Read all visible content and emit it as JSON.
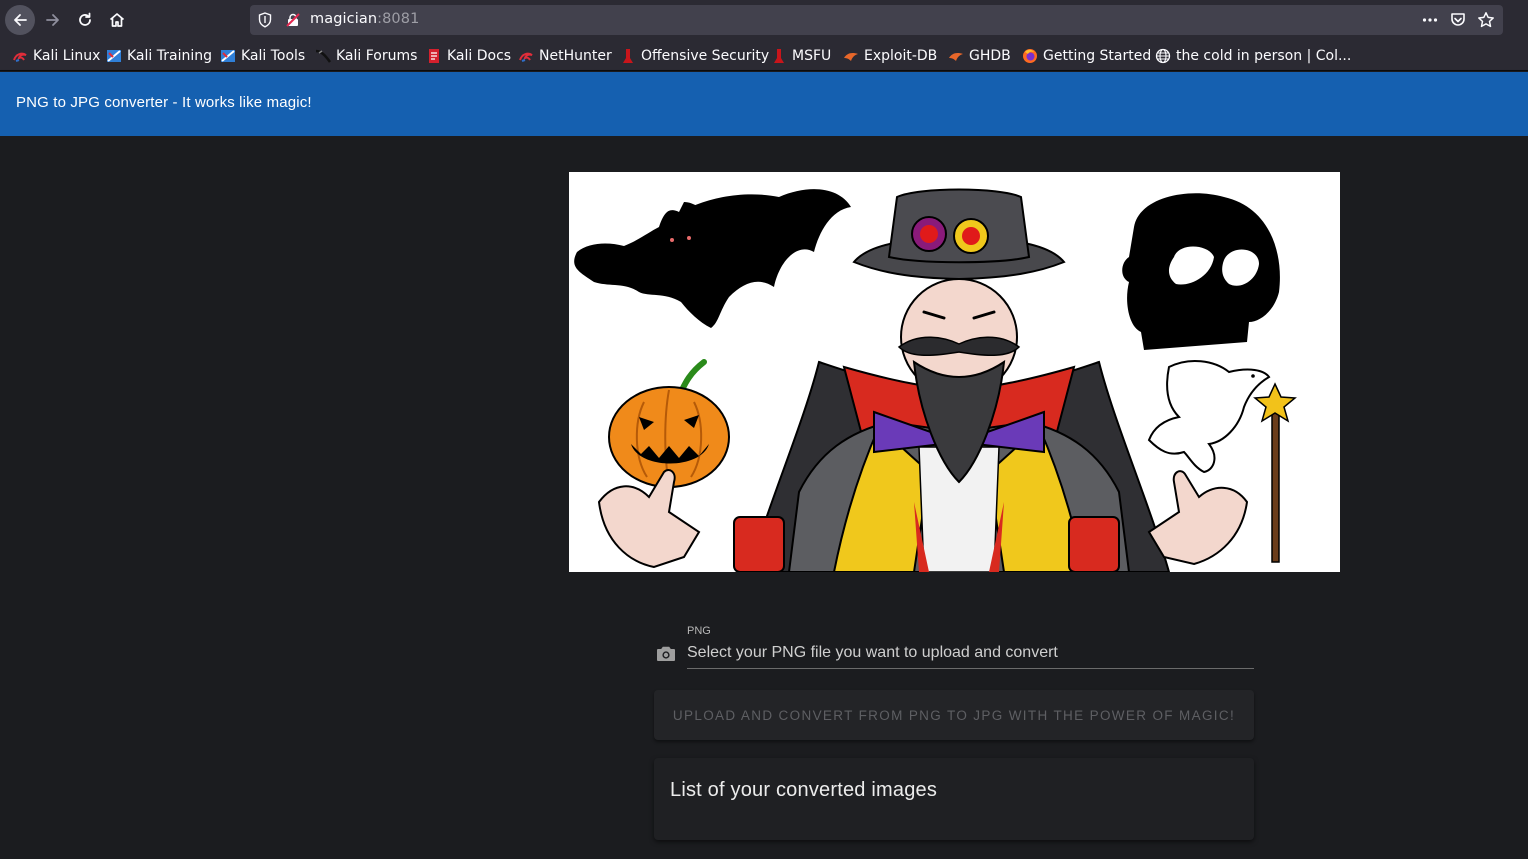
{
  "browser": {
    "url_host": "magician",
    "url_port": ":8081",
    "bookmarks": [
      {
        "label": "Kali Linux",
        "icon": "kali-dragon-icon"
      },
      {
        "label": "Kali Training",
        "icon": "kali-training-icon"
      },
      {
        "label": "Kali Tools",
        "icon": "kali-tools-icon"
      },
      {
        "label": "Kali Forums",
        "icon": "kali-forums-icon"
      },
      {
        "label": "Kali Docs",
        "icon": "kali-docs-icon"
      },
      {
        "label": "NetHunter",
        "icon": "nethunter-icon"
      },
      {
        "label": "Offensive Security",
        "icon": "offsec-icon"
      },
      {
        "label": "MSFU",
        "icon": "msfu-icon"
      },
      {
        "label": "Exploit-DB",
        "icon": "exploit-db-icon"
      },
      {
        "label": "GHDB",
        "icon": "ghdb-icon"
      },
      {
        "label": "Getting Started",
        "icon": "firefox-icon"
      },
      {
        "label": "the cold in person | Col...",
        "icon": "globe-icon"
      }
    ]
  },
  "app": {
    "title": "PNG to JPG converter - It works like magic!",
    "accent": "#1560b0",
    "background": "#1b1c1f"
  },
  "upload": {
    "label": "PNG",
    "placeholder": "Select your PNG file you want to upload and convert",
    "icon": "camera-icon",
    "button_label": "Upload and convert from PNG to JPG with the power of magic!"
  },
  "converted": {
    "title": "List of your converted images"
  }
}
